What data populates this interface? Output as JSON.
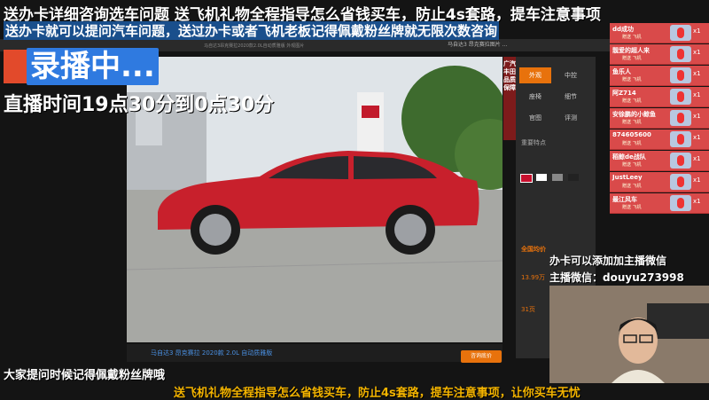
{
  "overlay": {
    "line1": "送办卡详细咨询选车问题  送飞机礼物全程指导怎么省钱买车，防止4s套路，提车注意事项",
    "line2": "送办卡就可以提问汽车问题，送过办卡或者飞机老板记得佩戴粉丝牌就无限次数咨询",
    "recording": "录播中...",
    "schedule": "直播时间19点30分到0点30分",
    "bottom_hint": "大家提问时候记得佩戴粉丝牌哦",
    "ticker": "送飞机礼物全程指导怎么省钱买车，防止4s套路，提车注意事项，让你买车无忧",
    "wechat_label": "办卡可以添加加主播微信",
    "wechat_id": "主播微信：douyu273998"
  },
  "browser": {
    "tab_title": "马自达3 昂克赛拉图片 ...",
    "subtitle": "马自达3昂克赛拉2020款2.0L自动质雅版 外观图片"
  },
  "photo": {
    "caption": "马自达3 昂克赛拉  2020款 2.0L 自动质雅版",
    "inquiry_button": "咨询底价",
    "vertical_title": "广汽丰田品质保障"
  },
  "side_panel": {
    "tabs": [
      {
        "label": "外观",
        "active": true
      },
      {
        "label": "中控",
        "active": false
      },
      {
        "label": "座椅",
        "active": false
      },
      {
        "label": "细节",
        "active": false
      },
      {
        "label": "官图",
        "active": false
      },
      {
        "label": "评测",
        "active": false
      }
    ],
    "section_label": "重要特点",
    "price_label": "全国均价",
    "price": "13.99万",
    "count": "31页",
    "colors": [
      "#c8102e",
      "#ffffff",
      "#888888",
      "#222222"
    ]
  },
  "gifts": [
    {
      "name": "dd成功",
      "sub": "赠送 飞机",
      "count": "x1"
    },
    {
      "name": "靓爱的超人来",
      "sub": "赠送 飞机",
      "count": "x1"
    },
    {
      "name": "鱼乐人",
      "sub": "赠送 飞机",
      "count": "x1"
    },
    {
      "name": "阿Z714",
      "sub": "赠送 飞机",
      "count": "x1"
    },
    {
      "name": "安徐鹏的小鲸鱼",
      "sub": "赠送 飞机",
      "count": "x1"
    },
    {
      "name": "874605600",
      "sub": "赠送 飞机",
      "count": "x1"
    },
    {
      "name": "稻鲸de战队",
      "sub": "赠送 飞机",
      "count": "x1"
    },
    {
      "name": "JustLeey",
      "sub": "赠送 飞机",
      "count": "x1"
    },
    {
      "name": "最江风车",
      "sub": "赠送 飞机",
      "count": "x1"
    }
  ],
  "colors": {
    "accent_orange": "#e8720c",
    "gift_red": "#d94a4a",
    "recording_blue": "#2f7ae0",
    "ticker_yellow": "#f4b400"
  }
}
